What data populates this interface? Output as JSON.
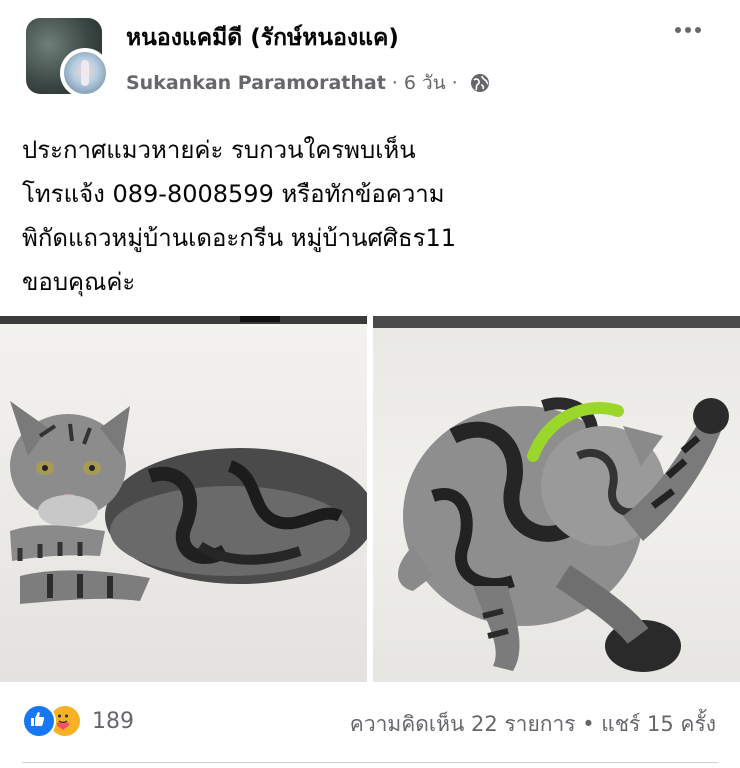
{
  "post": {
    "group_name": "หนองแคมีดี (รักษ์หนองแค)",
    "author": "Sukankan Paramorathat",
    "separator": "·",
    "time": "6 วัน",
    "separator2": "·",
    "privacy_icon": "globe-icon",
    "more_icon": "more-options-icon",
    "text_lines": [
      "ประกาศแมวหายค่ะ   รบกวนใครพบเห็น",
      "โทรแจ้ง 089-8008599 หรือทักข้อความ",
      "พิกัดแถวหมู่บ้านเดอะกรีน หมู่บ้านศศิธร11",
      "ขอบคุณค่ะ"
    ]
  },
  "photos": [
    {
      "subject": "silver tabby cat lying on floor",
      "icon": "photo"
    },
    {
      "subject": "silver tabby cat grooming with green collar",
      "icon": "photo"
    }
  ],
  "footer": {
    "reaction_icons": [
      "like-icon",
      "care-icon"
    ],
    "reaction_count": "189",
    "stats": "ความคิดเห็น 22 รายการ • แชร์ 15 ครั้ง"
  },
  "colors": {
    "text_primary": "#050505",
    "text_secondary": "#65676b",
    "like_blue": "#1877f2",
    "care_yellow": "#f7b125"
  }
}
